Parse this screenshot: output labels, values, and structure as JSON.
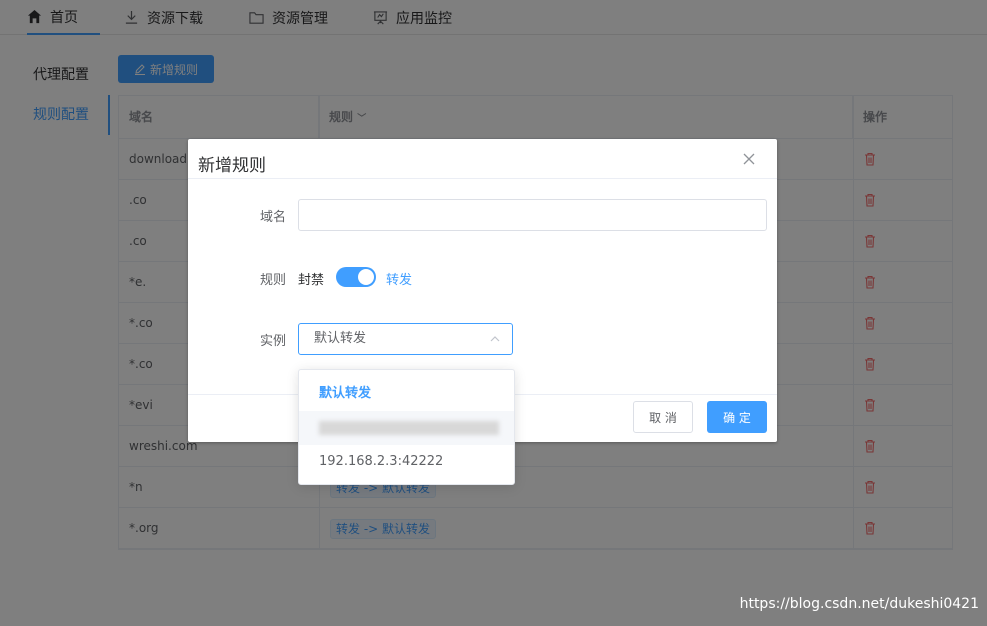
{
  "topnav": {
    "tabs": [
      {
        "label": "首页",
        "icon": "home-icon"
      },
      {
        "label": "资源下载",
        "icon": "download-icon"
      },
      {
        "label": "资源管理",
        "icon": "folder-icon"
      },
      {
        "label": "应用监控",
        "icon": "monitor-icon"
      }
    ],
    "active": 0
  },
  "sidebar": {
    "items": [
      {
        "label": "代理配置"
      },
      {
        "label": "规则配置"
      }
    ],
    "active": 1
  },
  "toolbar": {
    "new_rule_label": "新增规则"
  },
  "table": {
    "headers": {
      "domain": "域名",
      "rule": "规则",
      "action": "操作"
    },
    "rows": [
      {
        "domain": "download.",
        "rule": ""
      },
      {
        "domain": ".co",
        "rule": ""
      },
      {
        "domain": ".co",
        "rule": ""
      },
      {
        "domain": "*e.",
        "rule": ""
      },
      {
        "domain": "*.co",
        "rule": ""
      },
      {
        "domain": "*.co",
        "rule": ""
      },
      {
        "domain": "*evi",
        "rule": ""
      },
      {
        "domain": "wreshi.com",
        "rule": ""
      },
      {
        "domain": "*n",
        "rule": "转发 -> 默认转发"
      },
      {
        "domain": "*.org",
        "rule": "转发 -> 默认转发"
      }
    ]
  },
  "dialog": {
    "title": "新增规则",
    "domain_label": "域名",
    "domain_value": "",
    "rule_label": "规则",
    "rule_off_text": "封禁",
    "rule_on_text": "转发",
    "instance_label": "实例",
    "instance_value": "默认转发",
    "cancel_label": "取 消",
    "confirm_label": "确 定"
  },
  "dropdown": {
    "options": [
      {
        "label": "默认转发",
        "selected": true
      },
      {
        "label": "",
        "blurred": true
      },
      {
        "label": "192.168.2.3:42222"
      }
    ]
  },
  "watermark": "https://blog.csdn.net/dukeshi0421",
  "colors": {
    "accent": "#409eff",
    "danger": "#f56c6c"
  }
}
